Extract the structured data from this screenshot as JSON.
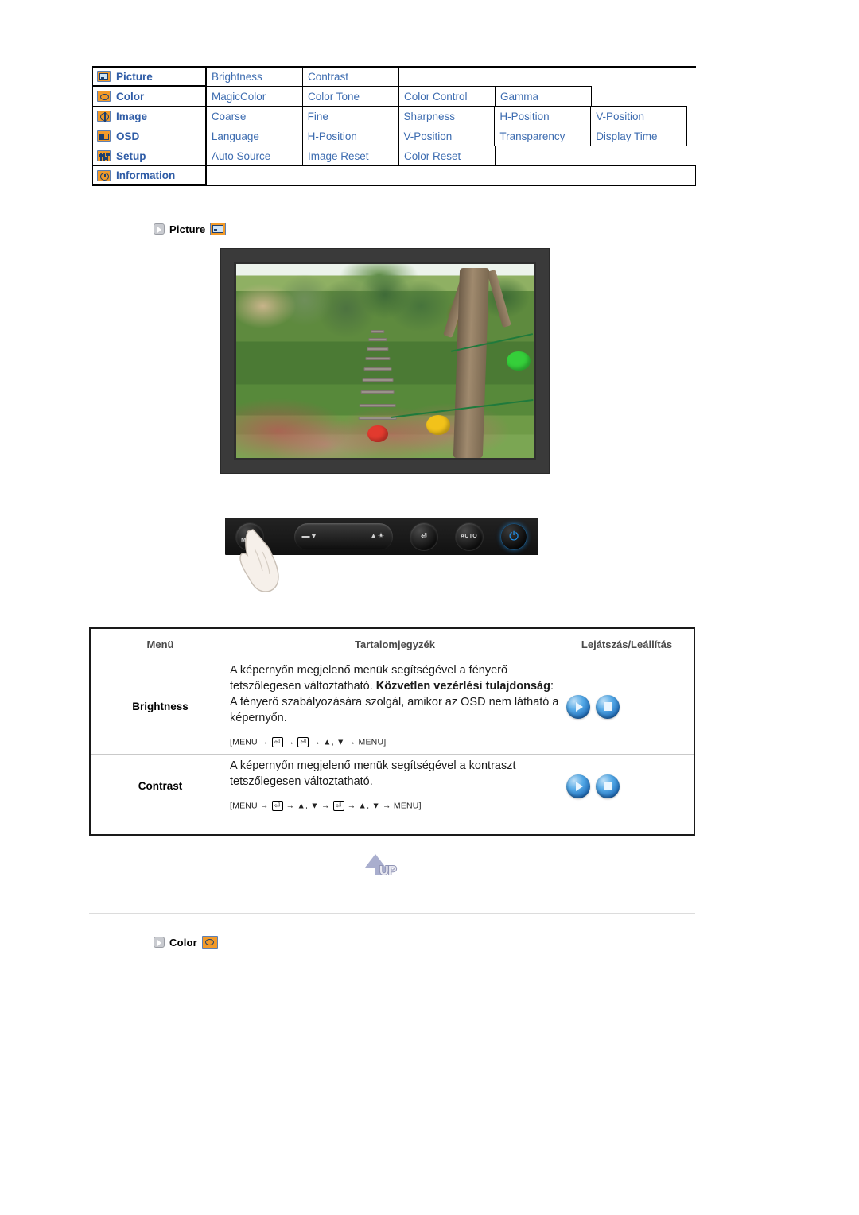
{
  "osd_map": {
    "rows": [
      {
        "icon": "picture-icon",
        "category": "Picture",
        "items": [
          "Brightness",
          "Contrast"
        ]
      },
      {
        "icon": "color-palette-icon",
        "category": "Color",
        "items": [
          "MagicColor",
          "Color Tone",
          "Color Control",
          "Gamma"
        ]
      },
      {
        "icon": "image-globe-icon",
        "category": "Image",
        "items": [
          "Coarse",
          "Fine",
          "Sharpness",
          "H-Position",
          "V-Position"
        ]
      },
      {
        "icon": "osd-window-icon",
        "category": "OSD",
        "items": [
          "Language",
          "H-Position",
          "V-Position",
          "Transparency",
          "Display Time"
        ]
      },
      {
        "icon": "setup-sliders-icon",
        "category": "Setup",
        "items": [
          "Auto Source",
          "Image Reset",
          "Color Reset"
        ]
      },
      {
        "icon": "information-clock-icon",
        "category": "Information",
        "items": []
      }
    ]
  },
  "sections": {
    "picture": {
      "bullet": "arrow-bullet-icon",
      "label": "Picture",
      "icon": "picture-icon"
    },
    "color": {
      "bullet": "arrow-bullet-icon",
      "label": "Color",
      "icon": "color-palette-icon"
    }
  },
  "monitor_photo": {
    "alt": "Monitor displaying a garden photo with stone pagoda, trees and paper lanterns"
  },
  "control_panel": {
    "buttons": [
      {
        "name": "menu-button",
        "label": "MENU",
        "glyph": "menu-icon"
      },
      {
        "name": "rocker-down-button",
        "label": "",
        "glyph": "down-arrow-icon"
      },
      {
        "name": "rocker-up-brightness-button",
        "label": "",
        "glyph": "up-arrow-brightness-icon"
      },
      {
        "name": "enter-button",
        "label": "",
        "glyph": "enter-icon"
      },
      {
        "name": "auto-button",
        "label": "AUTO",
        "glyph": "auto-icon"
      },
      {
        "name": "power-button",
        "label": "",
        "glyph": "power-icon"
      }
    ]
  },
  "desc_table": {
    "headers": {
      "menu": "Menü",
      "contents": "Tartalomjegyzék",
      "playstop": "Lejátszás/Leállítás"
    },
    "rows": [
      {
        "menu": "Brightness",
        "text_part1": "A képernyőn megjelenő menük segítségével a fényerő tetszőlegesen változtatható.",
        "bold_part": "Közvetlen vezérlési tulajdonság",
        "text_part2": ": A fényerő szabályozására szolgál, amikor az OSD nem látható a képernyőn.",
        "path": "[MENU → ⏎ → ⏎ → ▲, ▼ → MENU]",
        "path_tokens": [
          "[MENU",
          "→",
          "KEY_ENTER",
          "→",
          "KEY_ENTER",
          "→",
          "▲, ▼",
          "→",
          "MENU]"
        ],
        "play_label": "play-button",
        "stop_label": "stop-button"
      },
      {
        "menu": "Contrast",
        "text_part1": "A képernyőn megjelenő menük segítségével a kontraszt tetszőlegesen változtatható.",
        "bold_part": "",
        "text_part2": "",
        "path": "[MENU → ⏎ → ▲, ▼ → ⏎ → ▲, ▼ → MENU]",
        "path_tokens": [
          "[MENU",
          "→",
          "KEY_ENTER",
          "→",
          "▲, ▼",
          "→",
          "KEY_ENTER",
          "→",
          "▲, ▼",
          "→",
          "MENU]"
        ],
        "play_label": "play-button",
        "stop_label": "stop-button"
      }
    ]
  },
  "up_button": {
    "label": "UP"
  },
  "colors": {
    "menu_blue": "#3d6cb0",
    "category_blue": "#2f5ca6",
    "icon_orange": "#f29a29",
    "header_gray": "#4a4a4a",
    "button_blue": "#1c69b8"
  }
}
